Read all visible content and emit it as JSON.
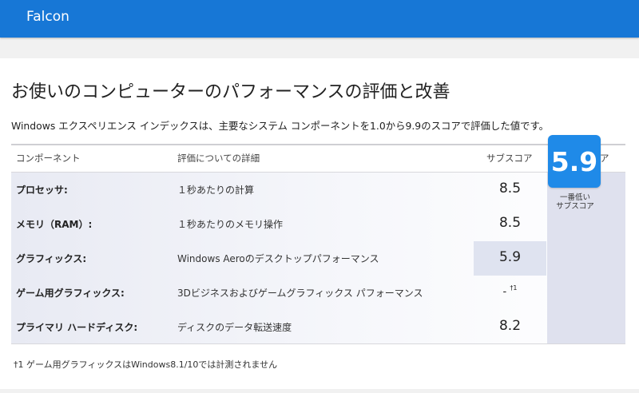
{
  "app": {
    "title": "Falcon"
  },
  "page": {
    "title": "お使いのコンピューターのパフォーマンスの評価と改善",
    "description": "Windows エクスペリエンス インデックスは、主要なシステム コンポーネントを1.0から9.9のスコアで評価した値です。"
  },
  "table": {
    "headers": {
      "component": "コンポーネント",
      "detail": "評価についての詳細",
      "subscore": "サブスコア",
      "basescore": "基本スコア"
    },
    "rows": [
      {
        "label": "プロセッサ:",
        "detail": "１秒あたりの計算",
        "subscore": "8.5"
      },
      {
        "label": "メモリ（RAM）:",
        "detail": "１秒あたりのメモリ操作",
        "subscore": "8.5"
      },
      {
        "label": "グラフィックス:",
        "detail": "Windows Aeroのデスクトップパフォーマンス",
        "subscore": "5.9"
      },
      {
        "label": "ゲーム用グラフィックス:",
        "detail": "3Dビジネスおよびゲームグラフィックス パフォーマンス",
        "subscore": "-",
        "subscore_note": "†1"
      },
      {
        "label": "プライマリ ハードディスク:",
        "detail": "ディスクのデータ転送速度",
        "subscore": "8.2"
      }
    ],
    "base_score": "5.9",
    "base_score_caption": "一番低い\nサブスコア"
  },
  "footnote": "†1 ゲーム用グラフィックスはWindows8.1/10では計測されません",
  "colors": {
    "titlebar": "#1777d6",
    "score_box": "#1f8ae8",
    "base_column": "#dfe1ee",
    "lowest_highlight": "#dfe3f0"
  }
}
